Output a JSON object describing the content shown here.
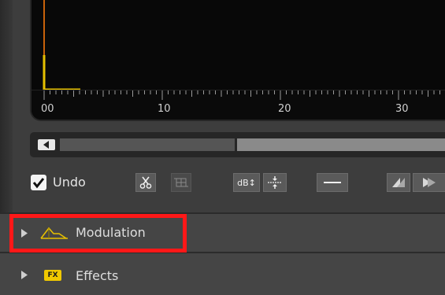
{
  "waveform": {
    "ruler_labels": [
      "00",
      "10",
      "20",
      "30"
    ]
  },
  "scrollbar": {
    "left_arrow_icon": "triangle-left-icon"
  },
  "toolbar": {
    "undo_checked": true,
    "undo_label": "Undo",
    "buttons": [
      {
        "name": "cut-button",
        "icon": "scissors-icon"
      },
      {
        "name": "crop-button",
        "icon": "crop-grid-icon"
      },
      {
        "name": "db-scale-button",
        "label": "dB↕"
      },
      {
        "name": "zoom-fit-button",
        "icon": "fit-arrows-icon"
      },
      {
        "name": "flat-line-button",
        "icon": "horizontal-line-icon"
      },
      {
        "name": "fade-in-button",
        "icon": "fade-in-icon"
      },
      {
        "name": "fade-out-button",
        "icon": "fade-out-icon"
      }
    ]
  },
  "sections": [
    {
      "label": "Modulation",
      "icon": "envelope-icon",
      "highlighted": true
    },
    {
      "label": "Effects",
      "icon": "fx-badge-icon",
      "badge": "FX"
    }
  ],
  "colors": {
    "highlight": "#ff1818",
    "waveform_line": "#e6c000",
    "playhead": "#c8620a",
    "fx_badge": "#f0c800"
  }
}
